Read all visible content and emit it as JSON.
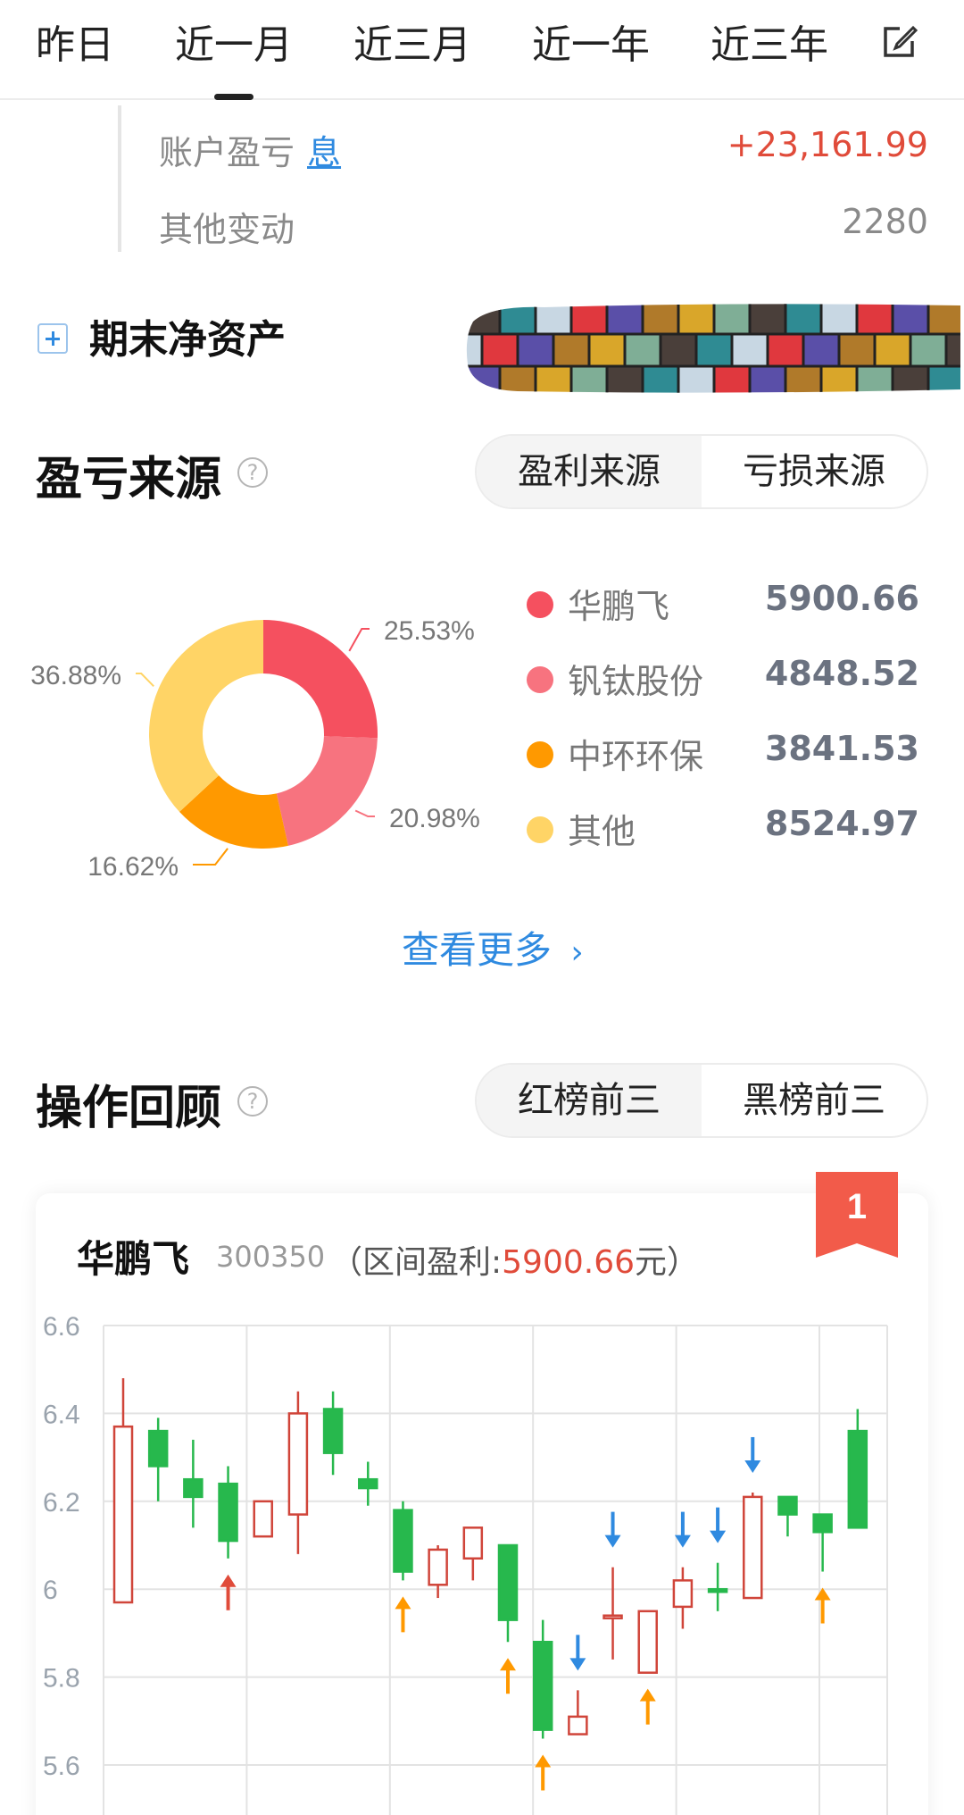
{
  "tabs": [
    "昨日",
    "近一月",
    "近三月",
    "近一年",
    "近三年"
  ],
  "active_tab": "近一月",
  "summary": {
    "account_pl_label": "账户盈亏",
    "account_pl_link": "息",
    "account_pl_value": "+23,161.99",
    "other_change_label": "其他变动",
    "other_change_value": "2280"
  },
  "net_asset_label": "期末净资产",
  "pl_source": {
    "title": "盈亏来源",
    "toggle": [
      "盈利来源",
      "亏损来源"
    ],
    "more": "查看更多"
  },
  "chart_data": [
    {
      "type": "pie",
      "donut": true,
      "slices": [
        {
          "name": "华鹏飞",
          "value": 5900.66,
          "percent": "25.53%",
          "color": "#f5505f"
        },
        {
          "name": "钒钛股份",
          "value": 4848.52,
          "percent": "20.98%",
          "color": "#f7737f"
        },
        {
          "name": "中环环保",
          "value": 3841.53,
          "percent": "16.62%",
          "color": "#ff9900"
        },
        {
          "name": "其他",
          "value": 8524.97,
          "percent": "36.88%",
          "color": "#ffd466"
        }
      ]
    },
    {
      "type": "candlestick",
      "ylim": [
        5.6,
        6.6
      ],
      "yticks": [
        "6.6",
        "6.4",
        "6.2",
        "6",
        "5.8",
        "5.6"
      ],
      "candles": [
        {
          "o": 5.97,
          "c": 6.37,
          "h": 6.48,
          "l": 5.97,
          "up": true
        },
        {
          "o": 6.36,
          "c": 6.28,
          "h": 6.39,
          "l": 6.2,
          "up": false
        },
        {
          "o": 6.25,
          "c": 6.21,
          "h": 6.34,
          "l": 6.14,
          "up": false
        },
        {
          "o": 6.24,
          "c": 6.11,
          "h": 6.28,
          "l": 6.07,
          "up": false,
          "mark": "up-red"
        },
        {
          "o": 6.12,
          "c": 6.2,
          "h": 6.2,
          "l": 6.12,
          "up": true
        },
        {
          "o": 6.17,
          "c": 6.4,
          "h": 6.45,
          "l": 6.08,
          "up": true
        },
        {
          "o": 6.41,
          "c": 6.31,
          "h": 6.45,
          "l": 6.26,
          "up": false
        },
        {
          "o": 6.25,
          "c": 6.23,
          "h": 6.29,
          "l": 6.19,
          "up": false
        },
        {
          "o": 6.18,
          "c": 6.04,
          "h": 6.2,
          "l": 6.02,
          "up": false,
          "mark": "up-orange"
        },
        {
          "o": 6.01,
          "c": 6.09,
          "h": 6.1,
          "l": 5.98,
          "up": true
        },
        {
          "o": 6.07,
          "c": 6.14,
          "h": 6.14,
          "l": 6.02,
          "up": true
        },
        {
          "o": 6.1,
          "c": 5.93,
          "h": 6.1,
          "l": 5.88,
          "up": false,
          "mark": "up-orange"
        },
        {
          "o": 5.88,
          "c": 5.68,
          "h": 5.93,
          "l": 5.66,
          "up": false,
          "mark": "up-orange"
        },
        {
          "o": 5.67,
          "c": 5.71,
          "h": 5.77,
          "l": 5.67,
          "up": true,
          "mark": "down-blue"
        },
        {
          "o": 5.94,
          "c": 5.94,
          "h": 6.05,
          "l": 5.84,
          "up": true,
          "mark": "down-blue"
        },
        {
          "o": 5.81,
          "c": 5.95,
          "h": 5.95,
          "l": 5.81,
          "up": true,
          "mark": "up-orange"
        },
        {
          "o": 5.96,
          "c": 6.02,
          "h": 6.05,
          "l": 5.91,
          "up": true,
          "mark": "down-blue"
        },
        {
          "o": 6.0,
          "c": 6.0,
          "h": 6.06,
          "l": 5.95,
          "up": false,
          "mark": "down-blue"
        },
        {
          "o": 5.98,
          "c": 6.21,
          "h": 6.22,
          "l": 5.98,
          "up": true,
          "mark": "down-blue"
        },
        {
          "o": 6.21,
          "c": 6.17,
          "h": 6.21,
          "l": 6.12,
          "up": false
        },
        {
          "o": 6.17,
          "c": 6.13,
          "h": 6.17,
          "l": 6.04,
          "up": false,
          "mark": "up-orange"
        },
        {
          "o": 6.14,
          "c": 6.36,
          "h": 6.41,
          "l": 6.14,
          "up": false
        }
      ]
    }
  ],
  "review": {
    "title": "操作回顾",
    "toggle": [
      "红榜前三",
      "黑榜前三"
    ],
    "rank": "1",
    "stock_name": "华鹏飞",
    "stock_code": "300350",
    "profit_prefix": "（区间盈利:",
    "profit_value": "5900.66",
    "profit_suffix": "元）"
  },
  "colors": {
    "up": "#d0453a",
    "down": "#27b84d",
    "blue_arrow": "#2f8ae0",
    "orange_arrow": "#ff9900",
    "red_arrow": "#e04b3a",
    "badge": "#f25b4a"
  }
}
